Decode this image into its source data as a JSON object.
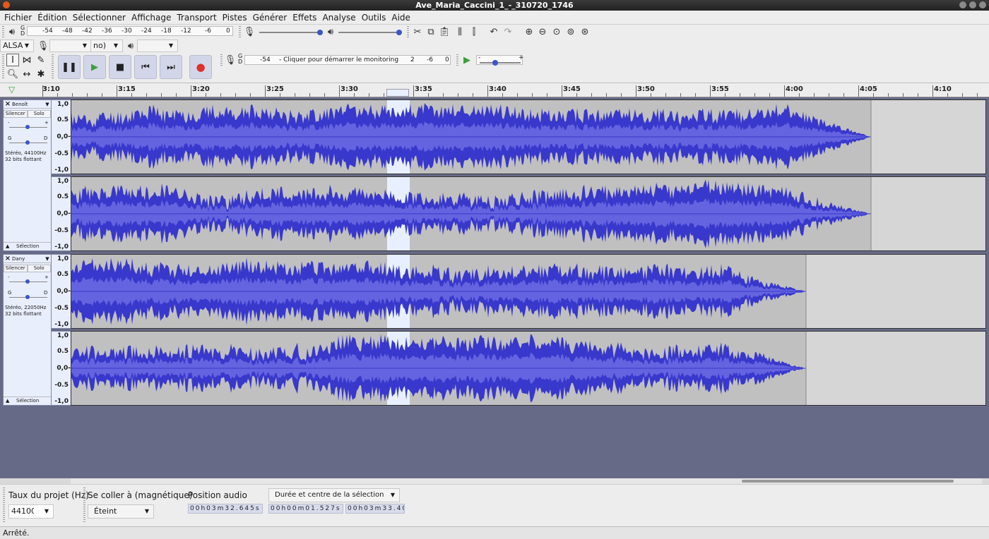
{
  "window": {
    "title": "Ave_Maria_Caccini_1_-_310720_1746"
  },
  "menu": [
    "Fichier",
    "Édition",
    "Sélectionner",
    "Affichage",
    "Transport",
    "Pistes",
    "Générer",
    "Effets",
    "Analyse",
    "Outils",
    "Aide"
  ],
  "meters": {
    "play_ticks": [
      "-54",
      "-48",
      "-42",
      "-36",
      "-30",
      "-24",
      "-18",
      "-12",
      "-6",
      "0"
    ],
    "g": "G",
    "d": "D",
    "rec_ticks_left": "-54",
    "rec_prompt": "Cliquer pour démarrer le monitoring",
    "rec_ticks_right": [
      "2",
      "-6",
      "0"
    ]
  },
  "device": {
    "host": "ALSA",
    "channels": "no)"
  },
  "transport": {
    "pause": "Pause",
    "play": "Lecture",
    "stop": "Arrêt",
    "skip_start": "Début",
    "skip_end": "Fin",
    "record": "Enregistrer",
    "record_color": "#e0302a"
  },
  "ruler": {
    "labels": [
      "3:10",
      "3:15",
      "3:20",
      "3:25",
      "3:30",
      "3:35",
      "3:40",
      "3:45",
      "3:50",
      "3:55",
      "4:00",
      "4:05",
      "4:10"
    ]
  },
  "tracks": [
    {
      "name": "Benoît",
      "mute": "Silencer",
      "solo": "Solo",
      "pan_l": "G",
      "pan_r": "D",
      "format": "Stéréo, 44100Hz",
      "depth": "32 bits flottant",
      "select": "Sélection",
      "scale": [
        "1,0",
        "0.5",
        "0,0-",
        "-0.5",
        "-1,0"
      ]
    },
    {
      "name": "Dany",
      "mute": "Silencer",
      "solo": "Solo",
      "pan_l": "G",
      "pan_r": "D",
      "format": "Stéréo, 22050Hz",
      "depth": "32 bits flottant",
      "select": "Sélection",
      "scale": [
        "1,0",
        "0.5",
        "0,0-",
        "-0.5",
        "-1,0"
      ]
    }
  ],
  "colors": {
    "wave": "#3838cc",
    "wave_rms": "#6464e0",
    "wave_bg": "#c0c0c0",
    "selection": "#e8f0ff",
    "tracks_bg": "#676a87"
  },
  "selectionbar": {
    "rate_label": "Taux du projet (Hz)",
    "rate_value": "44100",
    "snap_label": "Se coller à (magnétique)",
    "snap_value": "Éteint",
    "pos_label": "Position audio",
    "pos_value": "00h03m32.645s",
    "sel_mode": "Durée et centre de la sélection",
    "sel_len": "00h00m01.527s",
    "sel_center": "00h03m33.40"
  },
  "status": "Arrêté."
}
